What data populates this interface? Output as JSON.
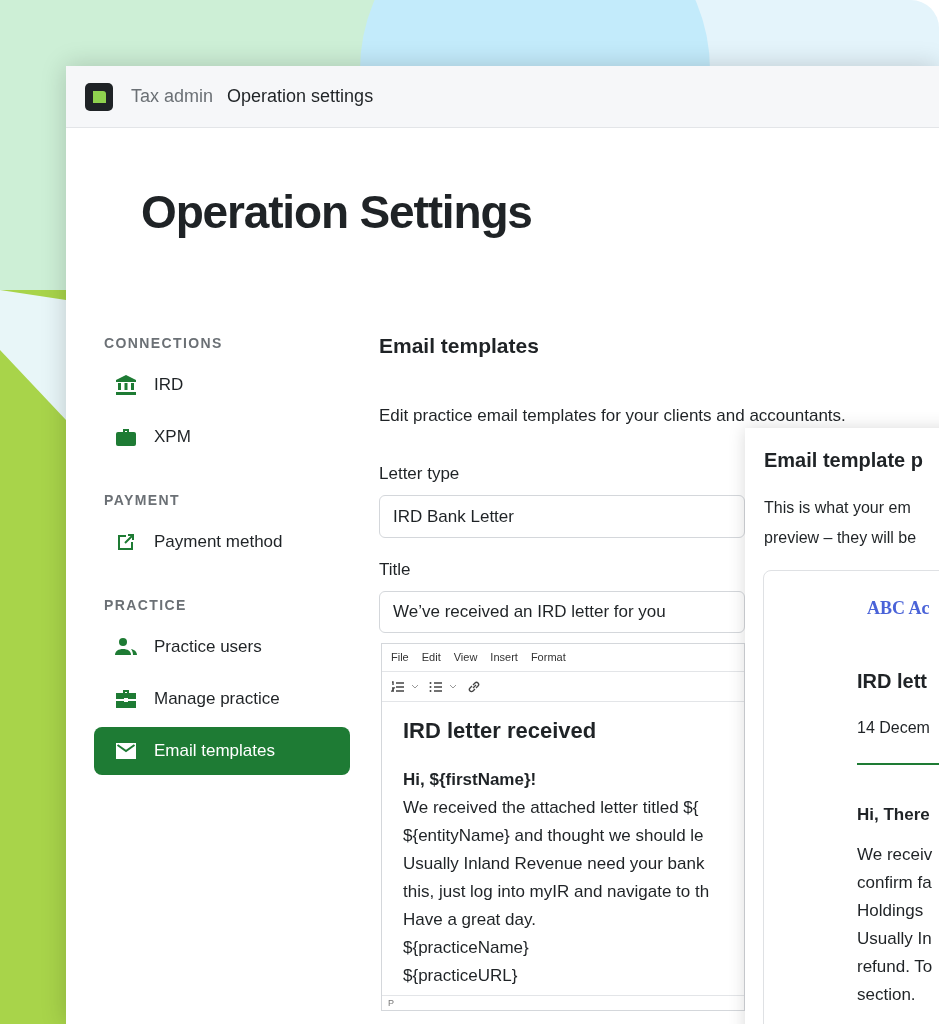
{
  "header": {
    "breadcrumbs": [
      {
        "label": "Tax admin",
        "current": false
      },
      {
        "label": "Operation settings",
        "current": true
      }
    ]
  },
  "page_title": "Operation Settings",
  "sidebar": {
    "sections": [
      {
        "heading": "CONNECTIONS",
        "items": [
          {
            "label": "IRD",
            "selected": false
          },
          {
            "label": "XPM",
            "selected": false
          }
        ]
      },
      {
        "heading": "PAYMENT",
        "items": [
          {
            "label": "Payment method",
            "selected": false
          }
        ]
      },
      {
        "heading": "PRACTICE",
        "items": [
          {
            "label": "Practice users",
            "selected": false
          },
          {
            "label": "Manage practice",
            "selected": false
          },
          {
            "label": "Email templates",
            "selected": true
          }
        ]
      }
    ]
  },
  "content": {
    "heading": "Email templates",
    "description": "Edit practice email templates for your clients and accountants.",
    "letter_type": {
      "label": "Letter type",
      "value": "IRD Bank Letter"
    },
    "title_field": {
      "label": "Title",
      "value": "We’ve received an IRD letter for you"
    },
    "editor": {
      "menu": [
        "File",
        "Edit",
        "View",
        "Insert",
        "Format"
      ],
      "heading": "IRD letter received",
      "greeting": "Hi, ${firstName}!",
      "body_lines": [
        "We received the attached letter titled ${",
        "${entityName} and thought we should le",
        "Usually Inland Revenue need your bank",
        "this, just log into myIR and navigate to th",
        "Have a great day.",
        "${practiceName}",
        "${practiceURL}"
      ],
      "status": "P"
    }
  },
  "preview": {
    "title": "Email template p",
    "description_lines": [
      "This is what your em",
      "preview – they will be"
    ],
    "card": {
      "sender": "ABC Ac",
      "heading": "IRD lett",
      "date": "14 Decem",
      "greeting": "Hi, There",
      "body_lines": [
        "We receiv",
        "confirm fa",
        "Holdings",
        "Usually In",
        "refund. To",
        "section."
      ]
    }
  }
}
